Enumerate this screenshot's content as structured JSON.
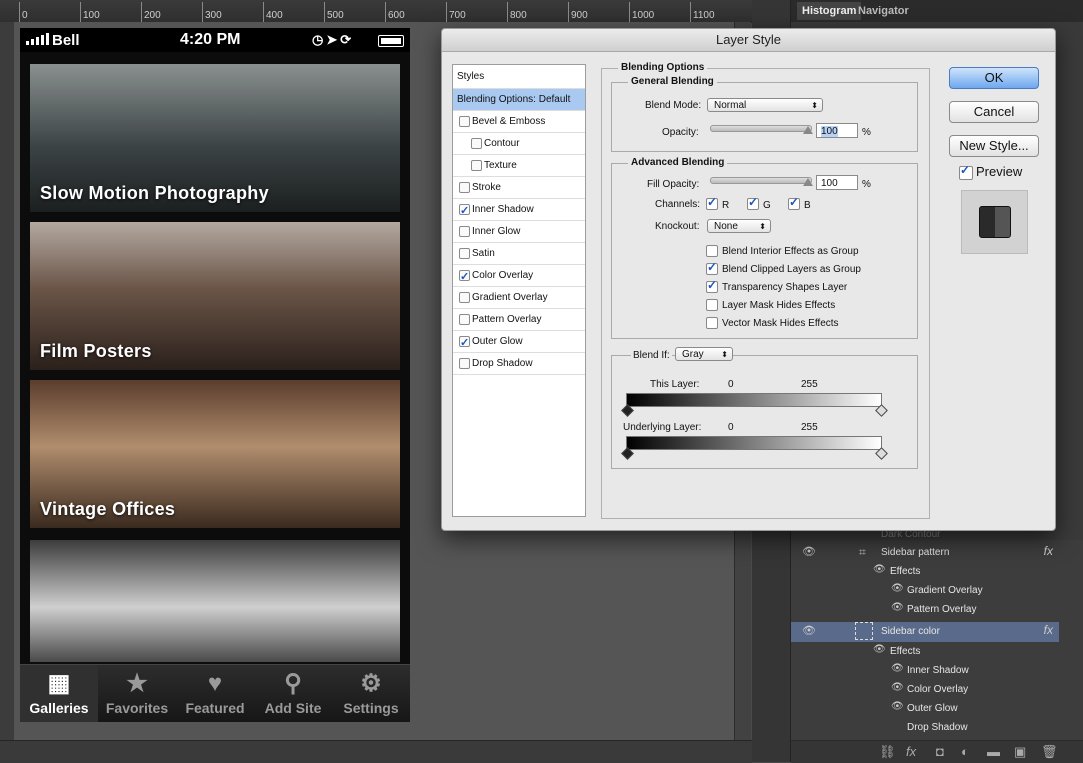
{
  "ruler": {
    "ticks": [
      "0",
      "100",
      "200",
      "300",
      "400",
      "500",
      "600",
      "700",
      "800",
      "900",
      "1000",
      "1100"
    ]
  },
  "phone": {
    "status": {
      "carrier": "Bell",
      "time": "4:20 PM"
    },
    "cards": [
      {
        "title": "Slow Motion Photography"
      },
      {
        "title": "Film Posters"
      },
      {
        "title": "Vintage Offices"
      },
      {
        "title": ""
      }
    ],
    "tabs": [
      {
        "label": "Galleries",
        "icon": "grid-icon",
        "glyph": "▦"
      },
      {
        "label": "Favorites",
        "icon": "star-icon",
        "glyph": "★"
      },
      {
        "label": "Featured",
        "icon": "heart-icon",
        "glyph": "♥"
      },
      {
        "label": "Add Site",
        "icon": "search-add-icon",
        "glyph": "⚲"
      },
      {
        "label": "Settings",
        "icon": "gear-icon",
        "glyph": "⚙"
      }
    ]
  },
  "panels": {
    "tabs": {
      "histogram": "Histogram",
      "navigator": "Navigator"
    },
    "layers": [
      {
        "name": "Sidebar pattern",
        "kind": "layer",
        "fx": true
      },
      {
        "name": "Effects",
        "kind": "effects"
      },
      {
        "name": "Gradient Overlay",
        "kind": "effect"
      },
      {
        "name": "Pattern Overlay",
        "kind": "effect"
      },
      {
        "name": "Sidebar color",
        "kind": "layer",
        "fx": true,
        "selected": true
      },
      {
        "name": "Effects",
        "kind": "effects"
      },
      {
        "name": "Inner Shadow",
        "kind": "effect"
      },
      {
        "name": "Color Overlay",
        "kind": "effect"
      },
      {
        "name": "Outer Glow",
        "kind": "effect"
      },
      {
        "name": "Drop Shadow",
        "kind": "effect-hidden"
      }
    ],
    "partial_layer": "Dark Contour",
    "fx_label": "fx"
  },
  "dialog": {
    "title": "Layer Style",
    "styles_header": "Styles",
    "styles": [
      {
        "label": "Blending Options: Default",
        "selected": true
      },
      {
        "label": "Bevel & Emboss",
        "checked": false
      },
      {
        "label": "Contour",
        "checked": false,
        "sub": true
      },
      {
        "label": "Texture",
        "checked": false,
        "sub": true
      },
      {
        "label": "Stroke",
        "checked": false
      },
      {
        "label": "Inner Shadow",
        "checked": true
      },
      {
        "label": "Inner Glow",
        "checked": false
      },
      {
        "label": "Satin",
        "checked": false
      },
      {
        "label": "Color Overlay",
        "checked": true
      },
      {
        "label": "Gradient Overlay",
        "checked": false
      },
      {
        "label": "Pattern Overlay",
        "checked": false
      },
      {
        "label": "Outer Glow",
        "checked": true
      },
      {
        "label": "Drop Shadow",
        "checked": false
      }
    ],
    "blending_options": "Blending Options",
    "general": {
      "title": "General Blending",
      "blend_mode_label": "Blend Mode:",
      "blend_mode": "Normal",
      "opacity_label": "Opacity:",
      "opacity": "100",
      "pct": "%"
    },
    "advanced": {
      "title": "Advanced Blending",
      "fill_label": "Fill Opacity:",
      "fill": "100",
      "pct": "%",
      "channels_label": "Channels:",
      "channels": [
        "R",
        "G",
        "B"
      ],
      "knockout_label": "Knockout:",
      "knockout": "None",
      "checks": [
        {
          "label": "Blend Interior Effects as Group",
          "checked": false
        },
        {
          "label": "Blend Clipped Layers as Group",
          "checked": true
        },
        {
          "label": "Transparency Shapes Layer",
          "checked": true
        },
        {
          "label": "Layer Mask Hides Effects",
          "checked": false
        },
        {
          "label": "Vector Mask Hides Effects",
          "checked": false
        }
      ]
    },
    "blendif": {
      "label": "Blend If:",
      "value": "Gray",
      "this_layer": "This Layer:",
      "underlying": "Underlying Layer:",
      "min": "0",
      "max": "255"
    },
    "buttons": {
      "ok": "OK",
      "cancel": "Cancel",
      "new_style": "New Style..."
    },
    "preview_label": "Preview"
  }
}
